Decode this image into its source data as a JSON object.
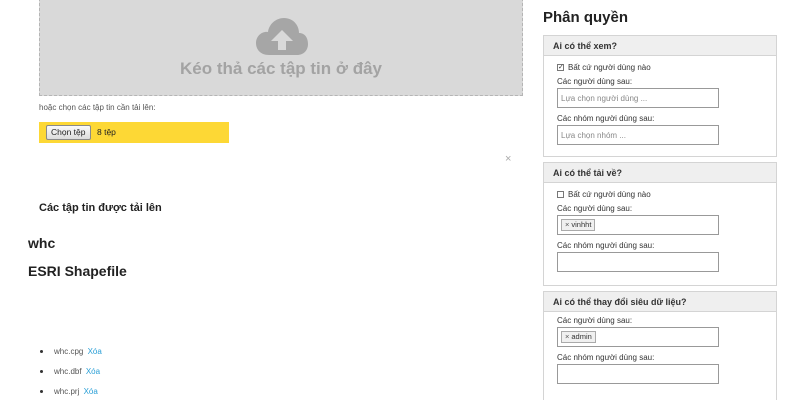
{
  "upload": {
    "drop_text": "Kéo thả các tập tin ở đây",
    "choose_hint": "hoặc chọn các tập tin cần tải lên:",
    "choose_button": "Chọn tệp",
    "file_count": "8 tệp",
    "close": "×"
  },
  "uploaded": {
    "title": "Các tập tin được tải lên",
    "layer_name": "whc",
    "layer_type": "ESRI Shapefile",
    "delete_label": "Xóa",
    "files": [
      "whc.cpg",
      "whc.dbf",
      "whc.prj"
    ]
  },
  "permissions": {
    "title": "Phân quyền",
    "view": {
      "header": "Ai có thể xem?",
      "anyone_label": "Bất cứ người dùng nào",
      "anyone_checked": true,
      "users_label": "Các người dùng sau:",
      "users_placeholder": "Lựa chọn người dùng ...",
      "groups_label": "Các nhóm người dùng sau:",
      "groups_placeholder": "Lựa chọn nhóm ..."
    },
    "download": {
      "header": "Ai có thể tải về?",
      "anyone_label": "Bất cứ người dùng nào",
      "anyone_checked": false,
      "users_label": "Các người dùng sau:",
      "user_tag": "vinhht",
      "groups_label": "Các nhóm người dùng sau:"
    },
    "metadata": {
      "header": "Ai có thể thay đổi siêu dữ liệu?",
      "users_label": "Các người dùng sau:",
      "user_tag": "admin",
      "groups_label": "Các nhóm người dùng sau:"
    },
    "tag_remove": "×"
  },
  "colors": {
    "dropzone": "#d9d9d9",
    "file_bar": "#fdd835",
    "link": "#2a9fd6"
  }
}
